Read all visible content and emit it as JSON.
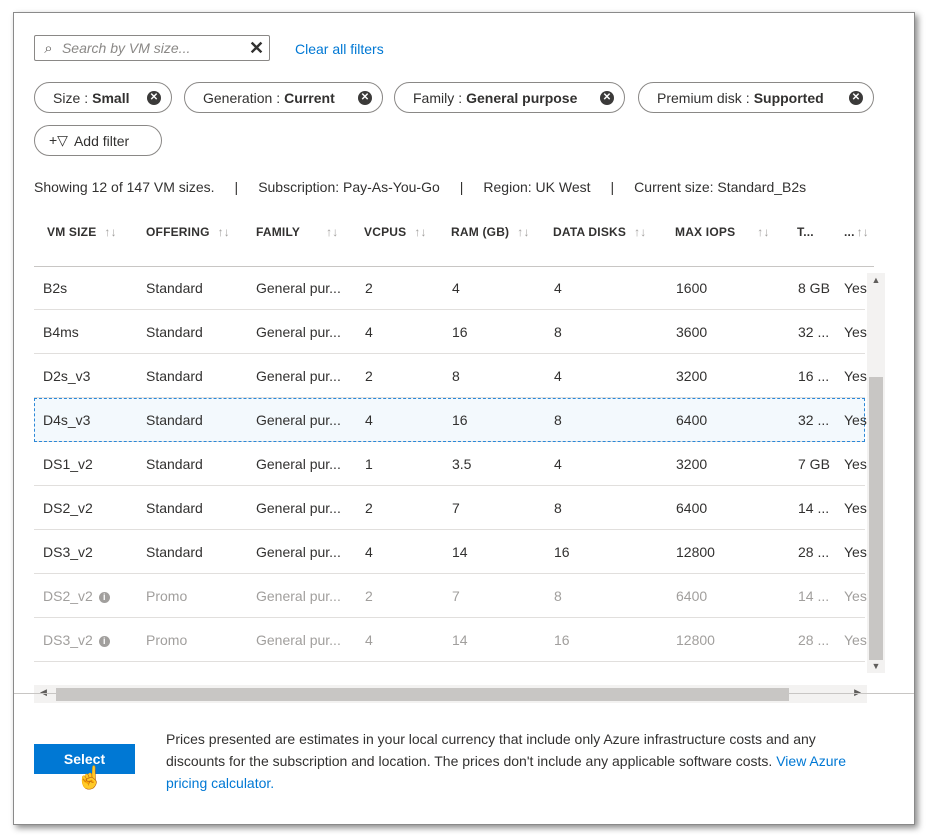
{
  "search": {
    "placeholder": "Search by VM size...",
    "value": ""
  },
  "clear_all_filters": "Clear all filters",
  "filters": [
    {
      "key": "Size",
      "value": "Small"
    },
    {
      "key": "Generation",
      "value": "Current"
    },
    {
      "key": "Family",
      "value": "General purpose"
    },
    {
      "key": "Premium disk",
      "value": "Supported"
    }
  ],
  "add_filter": "Add filter",
  "info": {
    "showing": "Showing 12 of 147 VM sizes.",
    "subscription": "Subscription: Pay-As-You-Go",
    "region": "Region: UK West",
    "current_size": "Current size: Standard_B2s"
  },
  "table": {
    "columns": [
      "VM SIZE",
      "OFFERING",
      "FAMILY",
      "VCPUS",
      "RAM (GB)",
      "DATA DISKS",
      "MAX IOPS",
      "T...",
      "..."
    ],
    "rows": [
      {
        "size": "B2s",
        "offering": "Standard",
        "family": "General pur...",
        "vcpus": "2",
        "ram": "4",
        "disks": "4",
        "iops": "1600",
        "temp": "8 GB",
        "premium": "Yes",
        "promo": false,
        "selected": false
      },
      {
        "size": "B4ms",
        "offering": "Standard",
        "family": "General pur...",
        "vcpus": "4",
        "ram": "16",
        "disks": "8",
        "iops": "3600",
        "temp": "32 ...",
        "premium": "Yes",
        "promo": false,
        "selected": false
      },
      {
        "size": "D2s_v3",
        "offering": "Standard",
        "family": "General pur...",
        "vcpus": "2",
        "ram": "8",
        "disks": "4",
        "iops": "3200",
        "temp": "16 ...",
        "premium": "Yes",
        "promo": false,
        "selected": false
      },
      {
        "size": "D4s_v3",
        "offering": "Standard",
        "family": "General pur...",
        "vcpus": "4",
        "ram": "16",
        "disks": "8",
        "iops": "6400",
        "temp": "32 ...",
        "premium": "Yes",
        "promo": false,
        "selected": true
      },
      {
        "size": "DS1_v2",
        "offering": "Standard",
        "family": "General pur...",
        "vcpus": "1",
        "ram": "3.5",
        "disks": "4",
        "iops": "3200",
        "temp": "7 GB",
        "premium": "Yes",
        "promo": false,
        "selected": false
      },
      {
        "size": "DS2_v2",
        "offering": "Standard",
        "family": "General pur...",
        "vcpus": "2",
        "ram": "7",
        "disks": "8",
        "iops": "6400",
        "temp": "14 ...",
        "premium": "Yes",
        "promo": false,
        "selected": false
      },
      {
        "size": "DS3_v2",
        "offering": "Standard",
        "family": "General pur...",
        "vcpus": "4",
        "ram": "14",
        "disks": "16",
        "iops": "12800",
        "temp": "28 ...",
        "premium": "Yes",
        "promo": false,
        "selected": false
      },
      {
        "size": "DS2_v2",
        "offering": "Promo",
        "family": "General pur...",
        "vcpus": "2",
        "ram": "7",
        "disks": "8",
        "iops": "6400",
        "temp": "14 ...",
        "premium": "Yes",
        "promo": true,
        "selected": false
      },
      {
        "size": "DS3_v2",
        "offering": "Promo",
        "family": "General pur...",
        "vcpus": "4",
        "ram": "14",
        "disks": "16",
        "iops": "12800",
        "temp": "28 ...",
        "premium": "Yes",
        "promo": true,
        "selected": false
      }
    ]
  },
  "footer": {
    "select_label": "Select",
    "price_note": "Prices presented are estimates in your local currency that include only Azure infrastructure costs and any discounts for the subscription and location. The prices don't include any applicable software costs.",
    "pricing_link": "View Azure pricing calculator."
  },
  "colors": {
    "accent": "#0078d4",
    "promo_text": "#a19f9d",
    "selected_row_bg": "#f3f9fd"
  }
}
